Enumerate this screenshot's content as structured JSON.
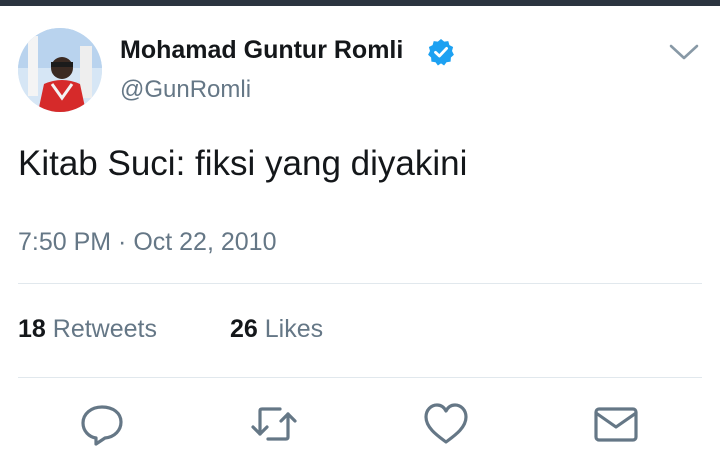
{
  "tweet": {
    "author_name": "Mohamad Guntur Romli",
    "handle": "@GunRomli",
    "verified": true,
    "text": "Kitab Suci: fiksi yang diyakini",
    "timestamp": "7:50 PM · Oct 22, 2010"
  },
  "stats": {
    "retweets_count": "18",
    "retweets_label": "Retweets",
    "likes_count": "26",
    "likes_label": "Likes"
  },
  "actions": [
    {
      "name": "reply",
      "icon": "reply-icon"
    },
    {
      "name": "retweet",
      "icon": "retweet-icon"
    },
    {
      "name": "like",
      "icon": "heart-icon"
    },
    {
      "name": "direct-message",
      "icon": "mail-icon"
    }
  ],
  "colors": {
    "text_primary": "#14171a",
    "text_secondary": "#657786",
    "divider": "#e1e8ed",
    "verified_blue": "#1da1f2",
    "icon_gray": "#657786"
  }
}
